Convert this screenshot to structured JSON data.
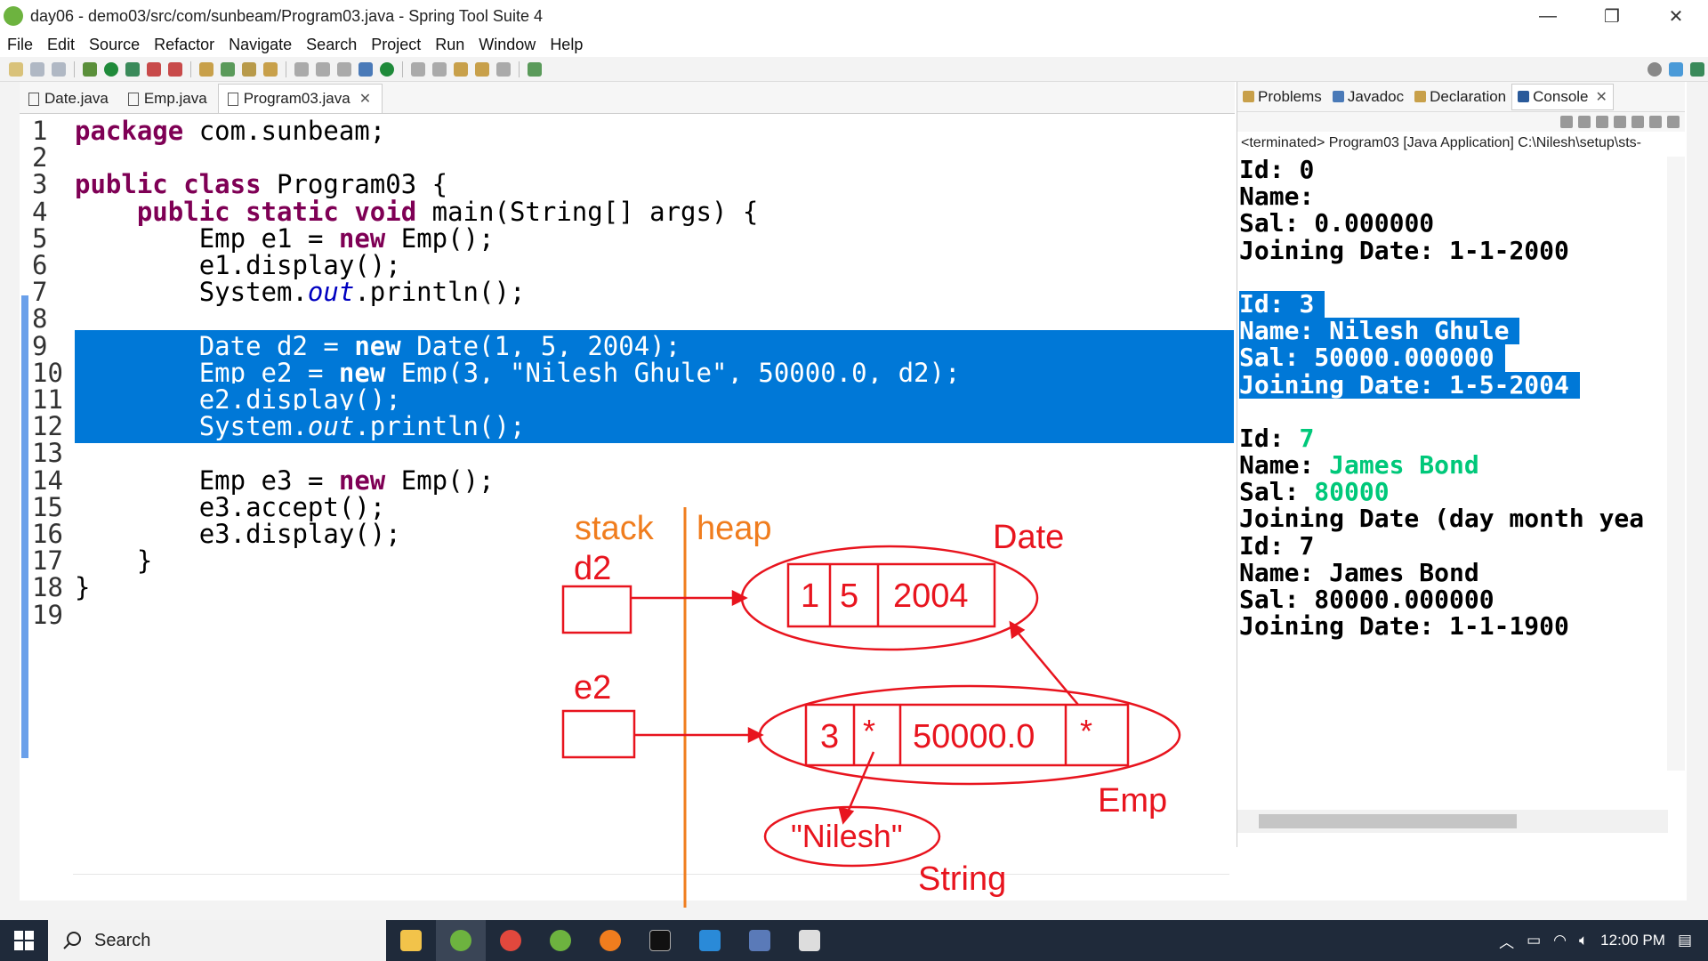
{
  "window": {
    "title": "day06 - demo03/src/com/sunbeam/Program03.java - Spring Tool Suite 4",
    "minimize": "—",
    "maximize": "❐",
    "close": "✕"
  },
  "menu": [
    "File",
    "Edit",
    "Source",
    "Refactor",
    "Navigate",
    "Search",
    "Project",
    "Run",
    "Window",
    "Help"
  ],
  "editor": {
    "tabs": [
      {
        "label": "Date.java",
        "active": false
      },
      {
        "label": "Emp.java",
        "active": false
      },
      {
        "label": "Program03.java",
        "active": true
      }
    ],
    "lines": [
      {
        "n": "1",
        "code": "package com.sunbeam;"
      },
      {
        "n": "2",
        "code": ""
      },
      {
        "n": "3",
        "code": "public class Program03 {"
      },
      {
        "n": "4",
        "code": "    public static void main(String[] args) {"
      },
      {
        "n": "5",
        "code": "        Emp e1 = new Emp();"
      },
      {
        "n": "6",
        "code": "        e1.display();"
      },
      {
        "n": "7",
        "code": "        System.out.println();"
      },
      {
        "n": "8",
        "code": ""
      },
      {
        "n": "9",
        "code": "        Date d2 = new Date(1, 5, 2004);"
      },
      {
        "n": "10",
        "code": "        Emp e2 = new Emp(3, \"Nilesh Ghule\", 50000.0, d2);"
      },
      {
        "n": "11",
        "code": "        e2.display();"
      },
      {
        "n": "12",
        "code": "        System.out.println();"
      },
      {
        "n": "13",
        "code": ""
      },
      {
        "n": "14",
        "code": "        Emp e3 = new Emp();"
      },
      {
        "n": "15",
        "code": "        e3.accept();"
      },
      {
        "n": "16",
        "code": "        e3.display();"
      },
      {
        "n": "17",
        "code": "    }"
      },
      {
        "n": "18",
        "code": "}"
      },
      {
        "n": "19",
        "code": ""
      }
    ],
    "selected_lines": [
      "9",
      "10",
      "11",
      "12"
    ]
  },
  "console": {
    "tabs": [
      {
        "label": "Problems",
        "active": false
      },
      {
        "label": "Javadoc",
        "active": false
      },
      {
        "label": "Declaration",
        "active": false
      },
      {
        "label": "Console",
        "active": true
      }
    ],
    "terminated": "<terminated> Program03 [Java Application] C:\\Nilesh\\setup\\sts-",
    "lines": [
      {
        "label": "Id: ",
        "value": "0",
        "style": "normal"
      },
      {
        "label": "Name: ",
        "value": "",
        "style": "normal"
      },
      {
        "label": "Sal: ",
        "value": "0.000000",
        "style": "normal"
      },
      {
        "label": "Joining Date: ",
        "value": "1-1-2000",
        "style": "normal"
      },
      {
        "label": "",
        "value": "",
        "style": "normal"
      },
      {
        "label": "Id: ",
        "value": "3",
        "style": "highlight"
      },
      {
        "label": "Name: ",
        "value": "Nilesh Ghule",
        "style": "highlight"
      },
      {
        "label": "Sal: ",
        "value": "50000.000000",
        "style": "highlight"
      },
      {
        "label": "Joining Date: ",
        "value": "1-5-2004",
        "style": "highlight"
      },
      {
        "label": "",
        "value": "",
        "style": "normal"
      },
      {
        "label": "Id: ",
        "value": "7",
        "style": "input"
      },
      {
        "label": "Name: ",
        "value": "James Bond",
        "style": "input"
      },
      {
        "label": "Sal: ",
        "value": "80000",
        "style": "input"
      },
      {
        "label": "Joining Date (day month yea",
        "value": "",
        "style": "normal"
      },
      {
        "label": "Id: ",
        "value": "7",
        "style": "normal"
      },
      {
        "label": "Name: ",
        "value": "James Bond",
        "style": "normal"
      },
      {
        "label": "Sal: ",
        "value": "80000.000000",
        "style": "normal"
      },
      {
        "label": "Joining Date: ",
        "value": "1-1-1900",
        "style": "normal"
      }
    ]
  },
  "annotation": {
    "stack": "stack",
    "heap": "heap",
    "d2": "d2",
    "e2": "e2",
    "date_label": "Date",
    "date_day": "1",
    "date_month": "5",
    "date_year": "2004",
    "emp_id": "3",
    "emp_name_ref": "*",
    "emp_sal": "50000.0",
    "emp_date_ref": "*",
    "emp_label": "Emp",
    "string_value": "\"Nilesh\"",
    "string_label": "String",
    "color": "#e8141e",
    "divider_color": "#f07d1e"
  },
  "taskbar": {
    "search": "Search",
    "time": "12:00 PM"
  }
}
